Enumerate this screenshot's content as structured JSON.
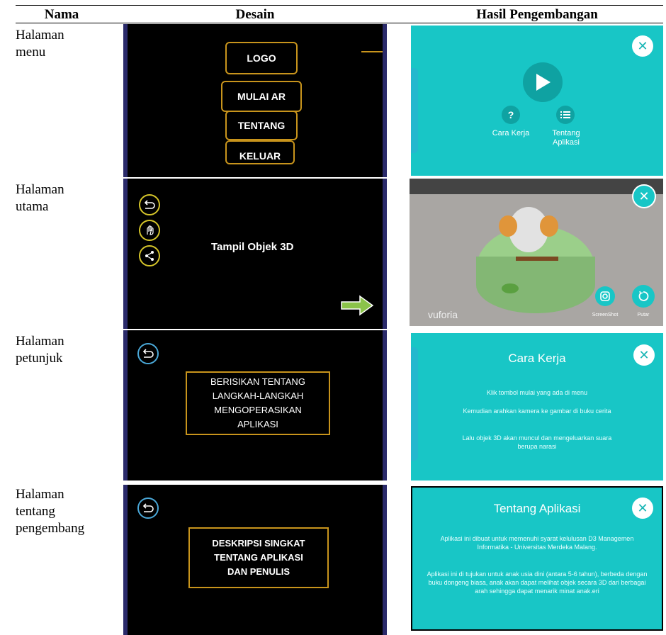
{
  "headers": {
    "nama": "Nama",
    "desain": "Desain",
    "hasil": "Hasil Pengembangan"
  },
  "rows": [
    {
      "nama": "Halaman menu",
      "desain": {
        "buttons": [
          "LOGO",
          "MULAI AR",
          "TENTANG",
          "KELUAR"
        ]
      },
      "hasil": {
        "cara_kerja": "Cara Kerja",
        "tentang_aplikasi": "Tentang Aplikasi"
      }
    },
    {
      "nama": "Halaman utama",
      "desain": {
        "label": "Tampil Objek 3D"
      },
      "hasil": {
        "brand": "vuforia",
        "screenshot": "ScreenShot",
        "putar": "Putar"
      }
    },
    {
      "nama": "Halaman petunjuk",
      "desain": {
        "box": "BERISIKAN TENTANG LANGKAH-LANGKAH MENGOPERASIKAN APLIKASI"
      },
      "hasil": {
        "title": "Cara Kerja",
        "p1": "Klik tombol mulai yang ada di menu",
        "p2": "Kemudian arahkan kamera ke gambar di buku cerita",
        "p3": "Lalu objek 3D akan muncul dan mengeluarkan suara berupa narasi"
      }
    },
    {
      "nama": "Halaman tentang pengembang",
      "desain": {
        "box": "DESKRIPSI SINGKAT TENTANG APLIKASI DAN PENULIS"
      },
      "hasil": {
        "title": "Tentang Aplikasi",
        "p1": "Aplikasi ini dibuat untuk memenuhi syarat kelulusan D3 Managemen Informatika - Universitas Merdeka Malang.",
        "p2": "Aplikasi ini di tujukan untuk anak usia dini (antara 5-6 tahun), berbeda dengan buku dongeng biasa, anak akan dapat melihat objek secara 3D dari berbagai arah sehingga dapat menarik minat anak.eri"
      }
    }
  ]
}
